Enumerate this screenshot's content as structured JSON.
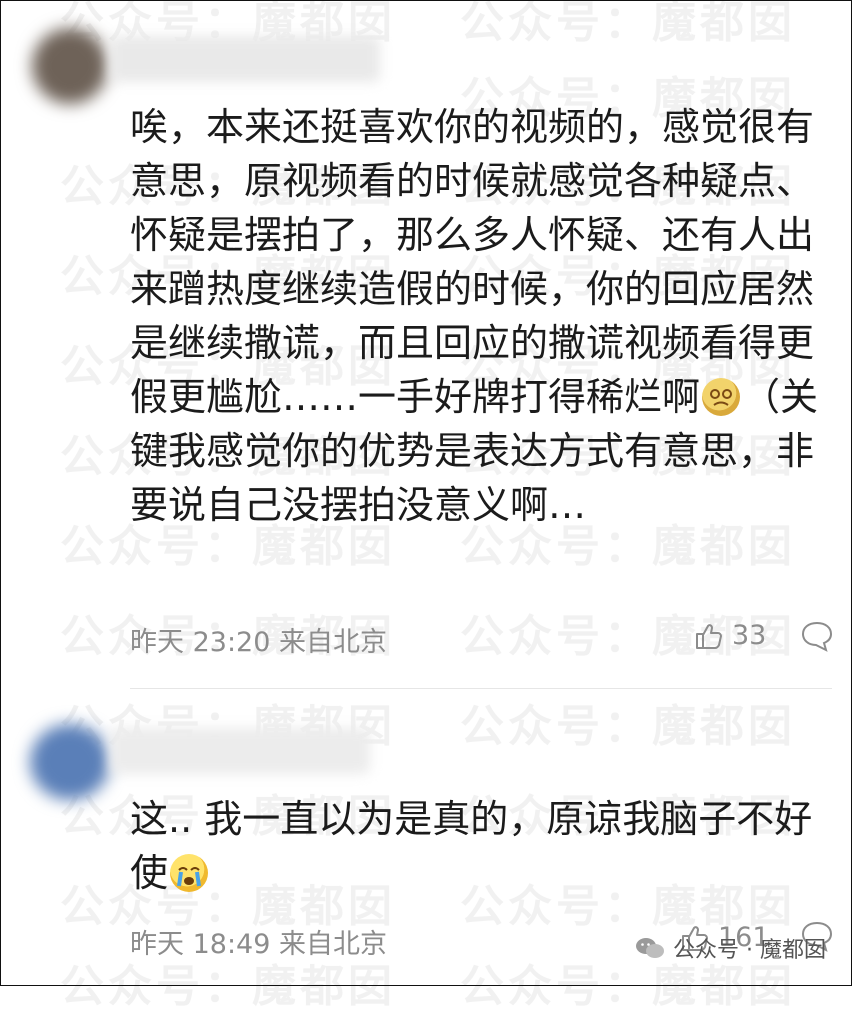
{
  "watermark": "公众号：魔都囡",
  "comments": [
    {
      "text_before_emoji": "唉，本来还挺喜欢你的视频的，感觉很有意思，原视频看的时候就感觉各种疑点、怀疑是摆拍了，那么多人怀疑、还有人出来蹭热度继续造假的时候，你的回应居然是继续撒谎，而且回应的撒谎视频看得更假更尴尬……一手好牌打得稀烂啊",
      "emoji": "spiral-face-emoji",
      "text_after_emoji": "（关键我感觉你的优势是表达方式有意思，非要说自己没摆拍没意义啊…",
      "time": "昨天 23:20",
      "location": "来自北京",
      "likes": "33"
    },
    {
      "text_before_emoji": "这.. 我一直以为是真的，原谅我脑子不好使",
      "emoji": "crying-face-emoji",
      "text_after_emoji": "",
      "time": "昨天 18:49",
      "location": "来自北京",
      "likes": "161"
    }
  ],
  "source_label": "公众号 · 魔都囡",
  "icons": {
    "like": "thumbs-up-icon",
    "reply": "speech-bubble-icon",
    "source": "wechat-icon"
  },
  "colors": {
    "meta": "#8c8c8c",
    "text": "#1b1b1b"
  }
}
